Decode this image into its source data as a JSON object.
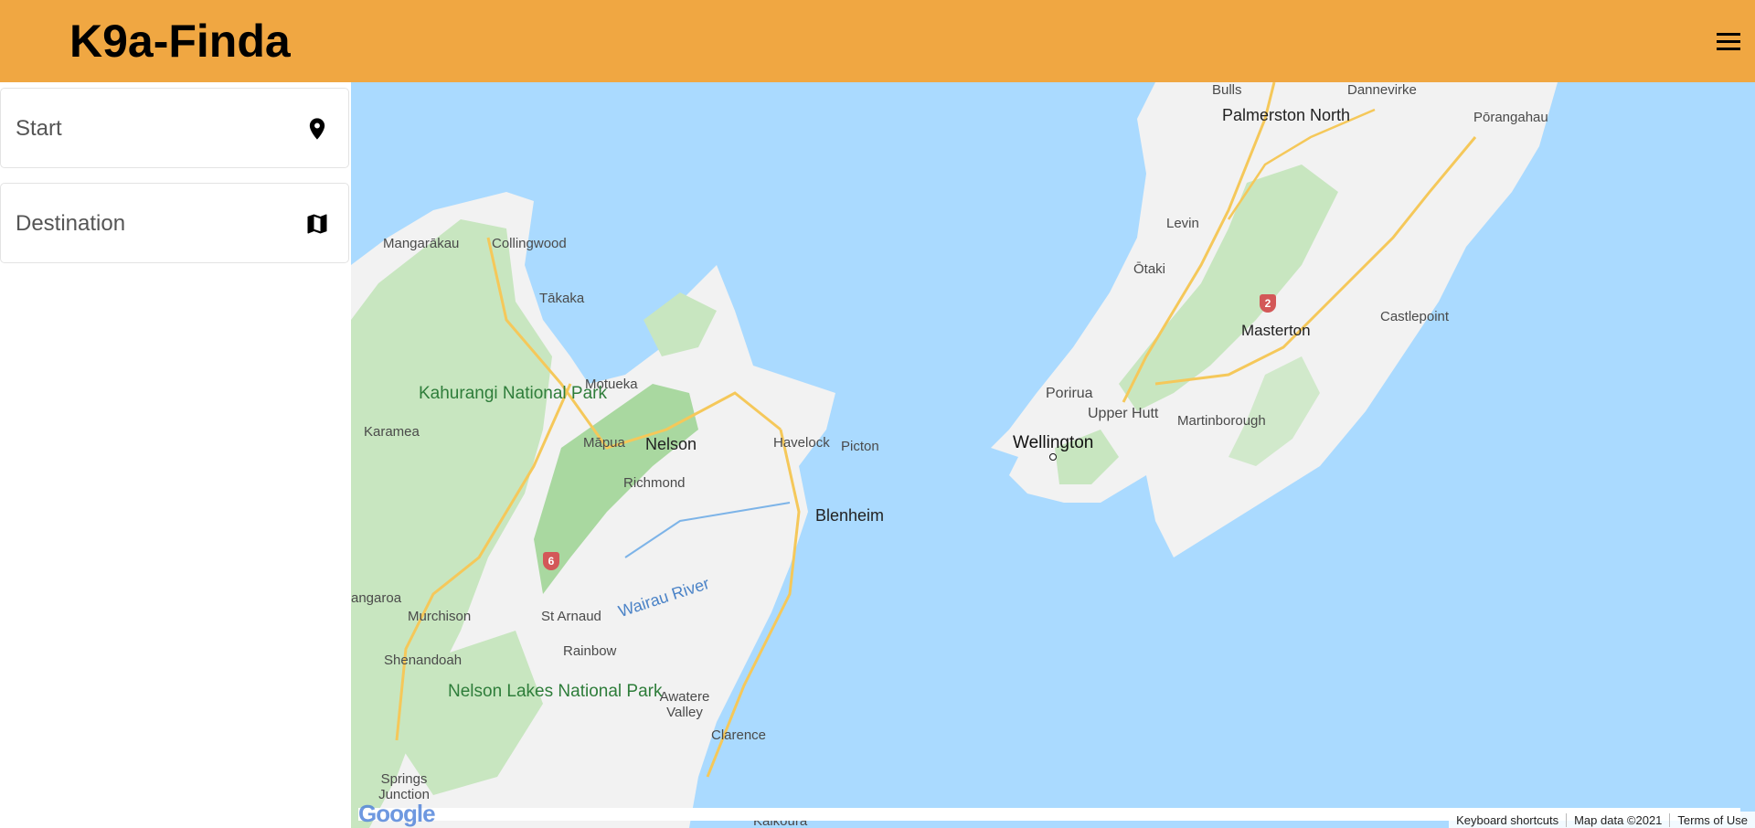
{
  "header": {
    "title": "K9a-Finda",
    "menu_icon": "hamburger-menu-icon",
    "background_color": "#f0a742"
  },
  "sidebar": {
    "start": {
      "placeholder": "Start",
      "icon": "location-pin-icon"
    },
    "destination": {
      "placeholder": "Destination",
      "icon": "map-icon"
    }
  },
  "map": {
    "water_color": "#aadaff",
    "land_color": "#f2f2f2",
    "park_color": "#c8e6c0",
    "labels": {
      "bulls": "Bulls",
      "dannevirke": "Dannevirke",
      "palmerston_north": "Palmerston North",
      "porangahau": "Pōrangahau",
      "levin": "Levin",
      "otaki": "Ōtaki",
      "masterton": "Masterton",
      "castlepoint": "Castlepoint",
      "porirua": "Porirua",
      "upper_hutt": "Upper Hutt",
      "martinborough": "Martinborough",
      "wellington": "Wellington",
      "mangarakau": "Mangarākau",
      "collingwood": "Collingwood",
      "takaka": "Tākaka",
      "motueka": "Motueka",
      "kahurangi": "Kahurangi National Park",
      "karamea": "Karamea",
      "mapua": "Māpua",
      "nelson": "Nelson",
      "richmond": "Richmond",
      "havelock": "Havelock",
      "picton": "Picton",
      "blenheim": "Blenheim",
      "wairau_river": "Wairau River",
      "angaroa": "angaroa",
      "murchison": "Murchison",
      "st_arnaud": "St Arnaud",
      "rainbow": "Rainbow",
      "shenandoah": "Shenandoah",
      "nelson_lakes": "Nelson Lakes National Park",
      "awatere_valley": "Awatere Valley",
      "clarence": "Clarence",
      "springs_junction": "Springs Junction",
      "kaikoura": "Kaikōura"
    },
    "shields": {
      "route_2": "2",
      "route_6": "6"
    },
    "attribution": {
      "keyboard": "Keyboard shortcuts",
      "map_data": "Map data ©2021",
      "terms": "Terms of Use"
    },
    "google_logo": "Google"
  }
}
